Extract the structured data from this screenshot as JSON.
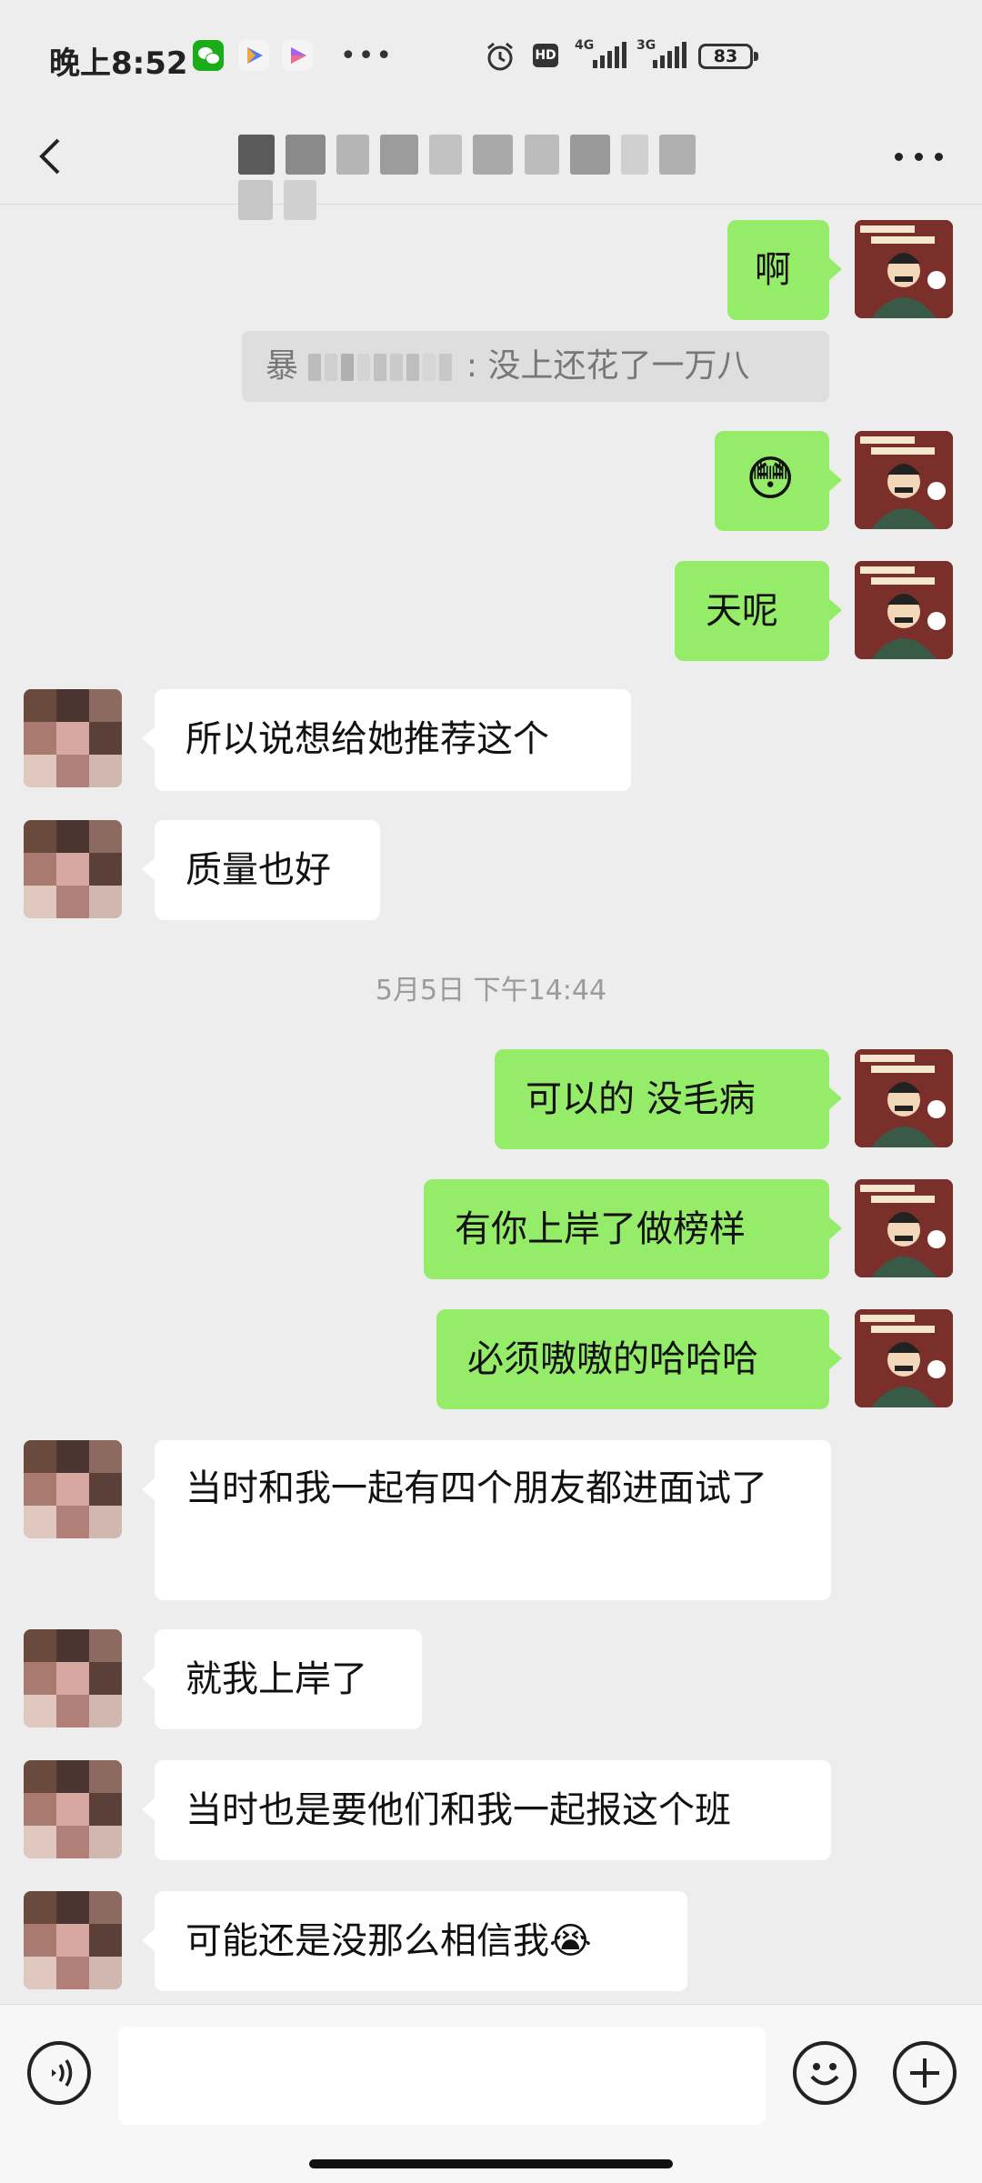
{
  "status_bar": {
    "time": "晚上8:52",
    "icons": [
      "wechat-icon",
      "play-icon",
      "play-icon",
      "more-icon",
      "alarm-icon",
      "hd-icon",
      "signal-4g-icon",
      "signal-3g-icon"
    ],
    "net1": "4G",
    "net2": "3G",
    "battery": "83"
  },
  "header": {
    "back_icon": "chevron-left-icon",
    "more_icon": "more-horizontal-icon"
  },
  "colors": {
    "sent_bubble": "#95ec69",
    "received_bubble": "#ffffff",
    "background": "#ededed"
  },
  "messages": {
    "m1": "啊",
    "quote_suffix": ": 没上还花了一万八",
    "quote_prefix": "暴",
    "m2_emoji": "😳",
    "m3": "天呢",
    "m4": "所以说想给她推荐这个",
    "m5": "质量也好",
    "timestamp": "5月5日 下午14:44",
    "m6": "可以的 没毛病",
    "m7": "有你上岸了做榜样",
    "m8": "必须嗷嗷的哈哈哈",
    "m9": "当时和我一起有四个朋友都进面试了",
    "m10": "就我上岸了",
    "m11": "当时也是要他们和我一起报这个班",
    "m12": "可能还是没那么相信我😭"
  },
  "input_bar": {
    "voice_icon": "voice-icon",
    "emoji_icon": "emoji-icon",
    "add_icon": "plus-icon"
  }
}
